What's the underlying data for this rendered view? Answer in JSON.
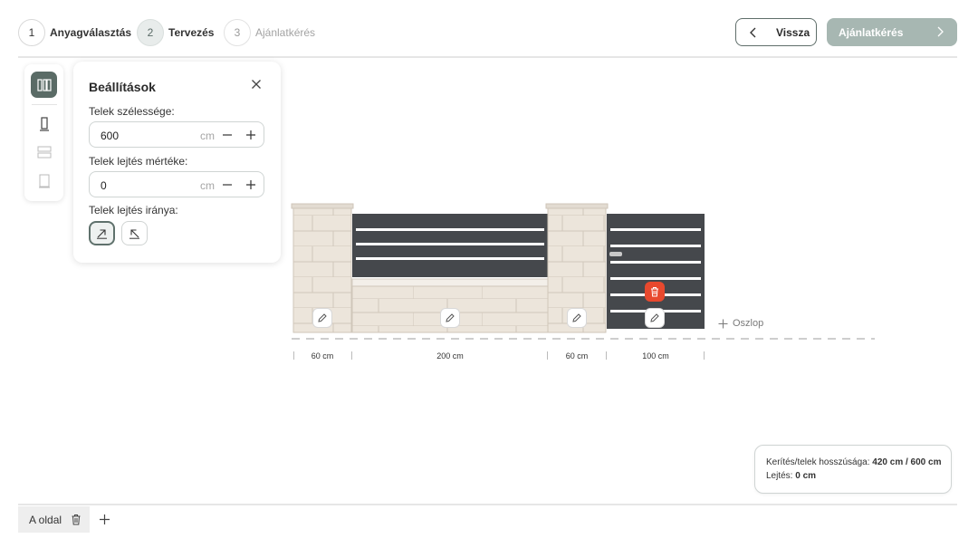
{
  "steps": [
    {
      "num": "1",
      "label": "Anyagválasztás",
      "state": "done"
    },
    {
      "num": "2",
      "label": "Tervezés",
      "state": "active"
    },
    {
      "num": "3",
      "label": "Ajánlatkérés",
      "state": "disabled"
    }
  ],
  "header": {
    "back_label": "Vissza",
    "offer_label": "Ajánlatkérés"
  },
  "toolbar": {
    "tools": [
      "fence-segments-icon",
      "post-icon",
      "panel-icon",
      "gate-icon"
    ],
    "active_tool": "fence-segments-icon"
  },
  "settings": {
    "title": "Beállítások",
    "width_label": "Telek szélessége:",
    "width_value": "600",
    "width_unit": "cm",
    "slope_label": "Telek lejtés mértéke:",
    "slope_value": "0",
    "slope_unit": "cm",
    "direction_label": "Telek lejtés iránya:",
    "direction_selected": "up-right"
  },
  "fence": {
    "add_column_label": "Oszlop",
    "dimensions": [
      "60 cm",
      "200 cm",
      "60 cm",
      "100 cm"
    ]
  },
  "info": {
    "length_label": "Kerítés/telek hosszúsága:",
    "length_value": "420 cm / 600 cm",
    "slope_label": "Lejtés:",
    "slope_value": "0 cm"
  },
  "sides": {
    "tab_label": "A oldal"
  },
  "colors": {
    "accent": "#5a6b66",
    "accent_light": "#a7b7b2",
    "danger": "#e8492e",
    "panel_dark": "#45484c",
    "stone": "#e9e2d8"
  }
}
